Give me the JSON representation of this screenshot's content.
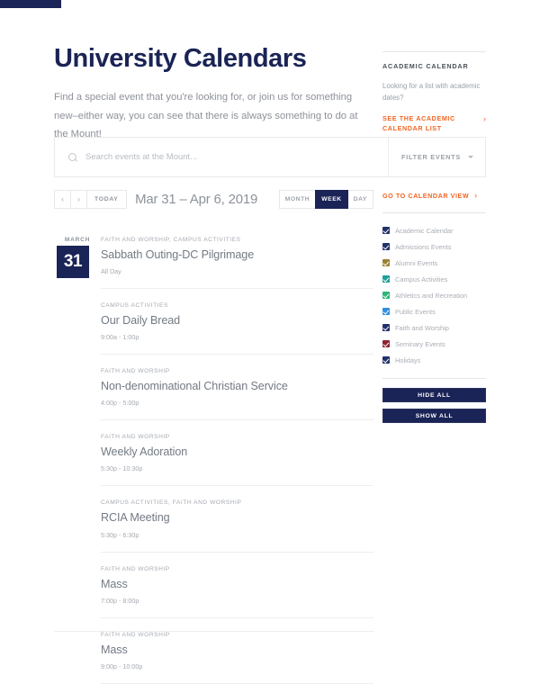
{
  "hero": {
    "title": "University Calendars",
    "intro": "Find a special event that you're looking for, or join us for something new–either way, you can see that there is always something to do at the Mount!"
  },
  "sidebar": {
    "promo": {
      "heading": "ACADEMIC CALENDAR",
      "text": "Looking for a list with academic dates?",
      "link_label": "SEE THE ACADEMIC CALENDAR LIST",
      "link_chevron": "›"
    },
    "calendar_view_link": {
      "label": "GO TO CALENDAR VIEW",
      "chevron": "›"
    },
    "filters": [
      {
        "label": "Academic Calendar",
        "color": "#22306b",
        "checked": true
      },
      {
        "label": "Admissions Events",
        "color": "#22306b",
        "checked": true
      },
      {
        "label": "Alumni Events",
        "color": "#9a8432",
        "checked": true
      },
      {
        "label": "Campus Activities",
        "color": "#1f9e9a",
        "checked": true
      },
      {
        "label": "Athletics and Recreation",
        "color": "#2bb673",
        "checked": true
      },
      {
        "label": "Public Events",
        "color": "#2f8fe0",
        "checked": true
      },
      {
        "label": "Faith and Worship",
        "color": "#22306b",
        "checked": true
      },
      {
        "label": "Seminary Events",
        "color": "#8f2231",
        "checked": true
      },
      {
        "label": "Holidays",
        "color": "#22306b",
        "checked": true
      }
    ],
    "actions": {
      "hide_all": "HIDE ALL",
      "show_all": "SHOW ALL"
    }
  },
  "search": {
    "placeholder": "Search events at the Mount...",
    "value": "",
    "filter_label": "FILTER EVENTS"
  },
  "toolbar": {
    "prev": "‹",
    "next": "›",
    "today": "TODAY",
    "range": "Mar 31 – Apr 6, 2019",
    "views": [
      {
        "label": "MONTH",
        "active": false
      },
      {
        "label": "WEEK",
        "active": true
      },
      {
        "label": "DAY",
        "active": false
      }
    ]
  },
  "day": {
    "month": "MARCH",
    "number": "31"
  },
  "events": [
    {
      "categories": "FAITH AND WORSHIP, CAMPUS ACTIVITIES",
      "title": "Sabbath Outing-DC Pilgrimage",
      "time": "All Day"
    },
    {
      "categories": "CAMPUS ACTIVITIES",
      "title": "Our Daily Bread",
      "time": "9:00a - 1:00p"
    },
    {
      "categories": "FAITH AND WORSHIP",
      "title": "Non-denominational Christian Service",
      "time": "4:00p - 5:00p"
    },
    {
      "categories": "FAITH AND WORSHIP",
      "title": "Weekly Adoration",
      "time": "5:30p - 10:30p"
    },
    {
      "categories": "CAMPUS ACTIVITIES, FAITH AND WORSHIP",
      "title": "RCIA Meeting",
      "time": "5:30p - 6:30p"
    },
    {
      "categories": "FAITH AND WORSHIP",
      "title": "Mass",
      "time": "7:00p - 8:00p"
    },
    {
      "categories": "FAITH AND WORSHIP",
      "title": "Mass",
      "time": "9:00p - 10:00p"
    }
  ],
  "theme": {
    "navy": "#1b2456",
    "orange": "#f26522",
    "muted": "#a5aab1"
  }
}
